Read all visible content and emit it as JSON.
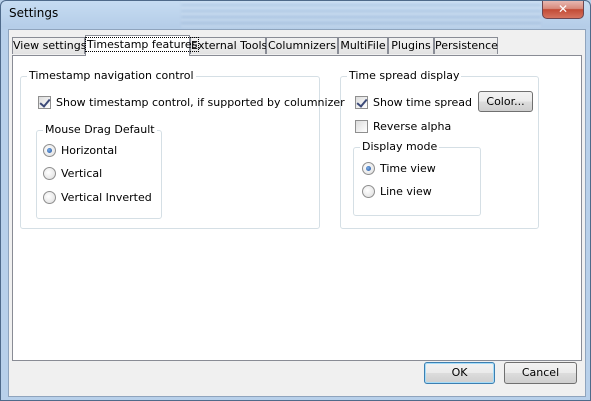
{
  "window": {
    "title": "Settings",
    "close_glyph": "✕"
  },
  "tabs": [
    {
      "label": "View settings"
    },
    {
      "label": "Timestamp features"
    },
    {
      "label": "External Tools"
    },
    {
      "label": "Columnizers"
    },
    {
      "label": "MultiFile"
    },
    {
      "label": "Plugins"
    },
    {
      "label": "Persistence"
    }
  ],
  "active_tab": "Timestamp features",
  "timestamp_nav": {
    "group_label": "Timestamp navigation control",
    "show_control": {
      "label": "Show timestamp control, if supported by columnizer",
      "checked": true
    },
    "mouse_drag": {
      "group_label": "Mouse Drag Default",
      "options": [
        {
          "label": "Horizontal",
          "selected": true
        },
        {
          "label": "Vertical",
          "selected": false
        },
        {
          "label": "Vertical Inverted",
          "selected": false
        }
      ]
    }
  },
  "time_spread": {
    "group_label": "Time spread display",
    "show_spread": {
      "label": "Show time spread",
      "checked": true
    },
    "color_button": "Color...",
    "reverse_alpha": {
      "label": "Reverse alpha",
      "checked": false
    },
    "display_mode": {
      "group_label": "Display mode",
      "options": [
        {
          "label": "Time view",
          "selected": true
        },
        {
          "label": "Line view",
          "selected": false
        }
      ]
    }
  },
  "footer": {
    "ok_label": "OK",
    "cancel_label": "Cancel"
  },
  "icons": {
    "checkbox": "checkbox-check-icon",
    "radio": "radio-dot-icon",
    "close": "close-icon"
  }
}
